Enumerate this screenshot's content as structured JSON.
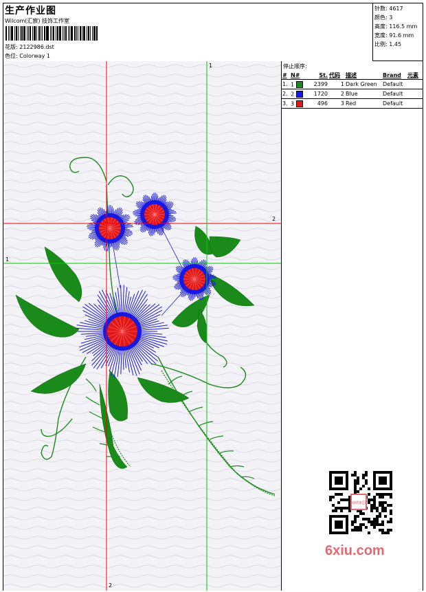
{
  "header": {
    "title": "生产作业图",
    "studio": "Wilcom(汇宸) 技饰工作室",
    "design": "花版: 2122986.dst",
    "colorway": "色位: Colorway 1"
  },
  "stats": {
    "stitches": "针数: 4617",
    "colors": "颜色: 3",
    "height": "高度: 116.5 mm",
    "width": "宽度: 91.6 mm",
    "scale": "比例: 1.45"
  },
  "stop_sequence": {
    "title": "停止顺序:",
    "columns": [
      "#",
      "N#",
      "St.",
      "代码",
      "描述",
      "Brand",
      "元素"
    ],
    "rows": [
      {
        "idx": "1.",
        "n": "1",
        "color_hex": "#1a8a1a",
        "st": "2399",
        "code": "1",
        "desc": "Dark Green",
        "brand": "Default"
      },
      {
        "idx": "2.",
        "n": "2",
        "color_hex": "#1818e0",
        "st": "1720",
        "code": "2",
        "desc": "Blue",
        "brand": "Default"
      },
      {
        "idx": "3.",
        "n": "3",
        "color_hex": "#e01818",
        "st": "496",
        "code": "3",
        "desc": "Red",
        "brand": "Default"
      }
    ]
  },
  "guides": {
    "red_v_label": "2",
    "red_h_label": "2",
    "green_v_label": "1",
    "green_h_label": "1"
  },
  "watermark": "6xiu.com",
  "qr_badge": "线绣家园",
  "colors": {
    "thread_green": "#1a8a1a",
    "thread_blue": "#1818e0",
    "thread_red": "#e01818",
    "guide_red": "#ff0000",
    "guide_green": "#00c800"
  }
}
